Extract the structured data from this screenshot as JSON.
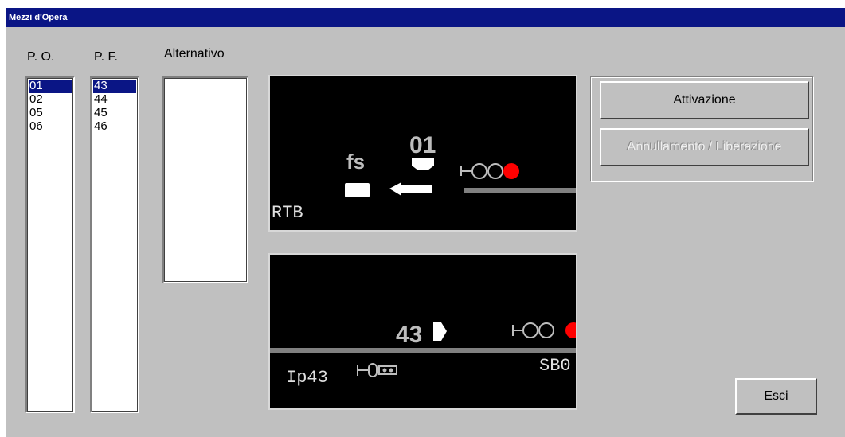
{
  "window": {
    "title": "Mezzi d'Opera"
  },
  "columns": {
    "po": "P. O.",
    "pf": "P. F.",
    "alt": "Alternativo"
  },
  "lists": {
    "po": [
      "01",
      "02",
      "05",
      "06"
    ],
    "pf": [
      "43",
      "44",
      "45",
      "46"
    ],
    "alt": []
  },
  "selected": {
    "po": "01",
    "pf": "43"
  },
  "panel_top": {
    "fs_label": "fs",
    "number": "01",
    "station_label": "RTB"
  },
  "panel_bottom": {
    "number": "43",
    "signal_label": "Ip43",
    "station_label": "SB0"
  },
  "buttons": {
    "activate": "Attivazione",
    "cancel": "Annullamento / Liberazione",
    "exit": "Esci"
  },
  "colors": {
    "titlebar": "#0a1585",
    "signal_red": "#ff0000",
    "track": "#808080"
  }
}
